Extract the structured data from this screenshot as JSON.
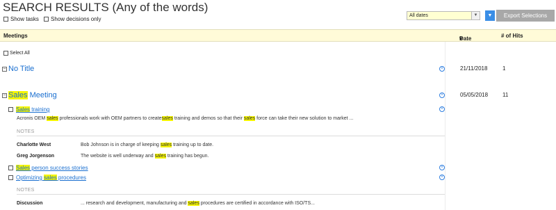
{
  "header": {
    "title": "SEARCH RESULTS (Any of the words)",
    "show_tasks": "Show tasks",
    "show_decisions": "Show decisions only",
    "date_filter": "All dates",
    "export_label": "Export Selections"
  },
  "columns": {
    "meetings": "Meetings",
    "date": "Date",
    "hits": "# of Hits"
  },
  "select_all": "Select All",
  "highlight_term": "sales",
  "meetings": [
    {
      "title": "No Title",
      "date": "21/11/2018",
      "hits": "1"
    },
    {
      "title_hl": "Sales",
      "title_rest": " Meeting",
      "date": "05/05/2018",
      "hits": "11",
      "items": [
        {
          "link_hl": "Sales",
          "link_rest": " training",
          "snippet": {
            "p1": "Acronis OEM ",
            "p2": " professionals work with OEM partners to create",
            "p3": " training and demos so that their ",
            "p4": " force can take their new solution to market ..."
          },
          "notes_label": "NOTES",
          "notes": [
            {
              "name": "Charlotte West",
              "pre": "Bob Johnson is in charge of keeping ",
              "post": " training up to date."
            },
            {
              "name": "Greg Jorgenson",
              "pre": "The website is well underway and ",
              "post": " training has begun."
            }
          ]
        },
        {
          "link_hl": "Sales",
          "link_rest": " person success stories"
        },
        {
          "link_pre": "Optimizing ",
          "link_hl": "sales",
          "link_rest": " procedures",
          "notes_label": "NOTES",
          "notes": [
            {
              "name": "Discussion",
              "pre": "... research and development, manufacturing and ",
              "post": " procedures are certified in accordance with ISO/TS..."
            }
          ]
        }
      ]
    }
  ],
  "colors": {
    "highlight": "#f5f500",
    "link": "#1a6fd0",
    "header_band": "#fffbd8",
    "button_blue": "#3a8ee6",
    "button_gray": "#a8a8a8"
  }
}
